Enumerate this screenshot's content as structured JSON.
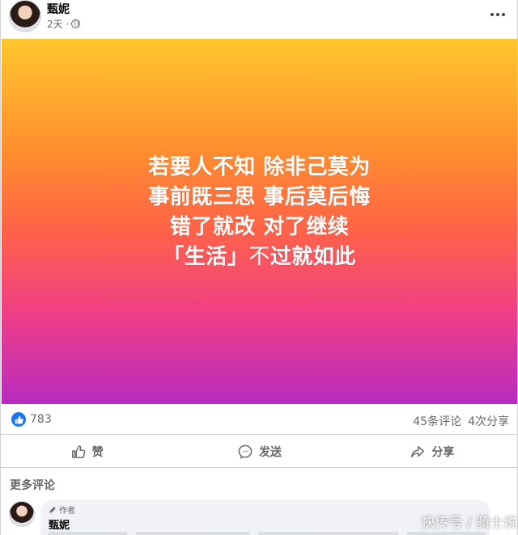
{
  "post": {
    "author": "甄妮",
    "time": "2天 ·",
    "lines": [
      "若要人不知 除非己莫为",
      "事前既三思 事后莫后悔",
      "错了就改 对了继续"
    ],
    "last_line_bold_a": "「生活」",
    "last_line_light": "不",
    "last_line_bold_b": "过就如此",
    "colors": {
      "top": "#ffc62e",
      "mid": "#ff6347",
      "bottom": "#b72bc1"
    }
  },
  "reactions": {
    "like_count": "783",
    "comments": "45条评论",
    "shares": "4次分享"
  },
  "actions": {
    "like": "赞",
    "send": "发送",
    "share": "分享"
  },
  "comments": {
    "more_label": "更多评论",
    "author_badge": "作者",
    "first_author": "甄妮"
  },
  "watermark": "快传号 / 骑士说",
  "icons": [
    "globe-icon",
    "more-options-icon",
    "like-reaction-icon",
    "like-icon",
    "messenger-icon",
    "share-icon",
    "pencil-icon"
  ]
}
